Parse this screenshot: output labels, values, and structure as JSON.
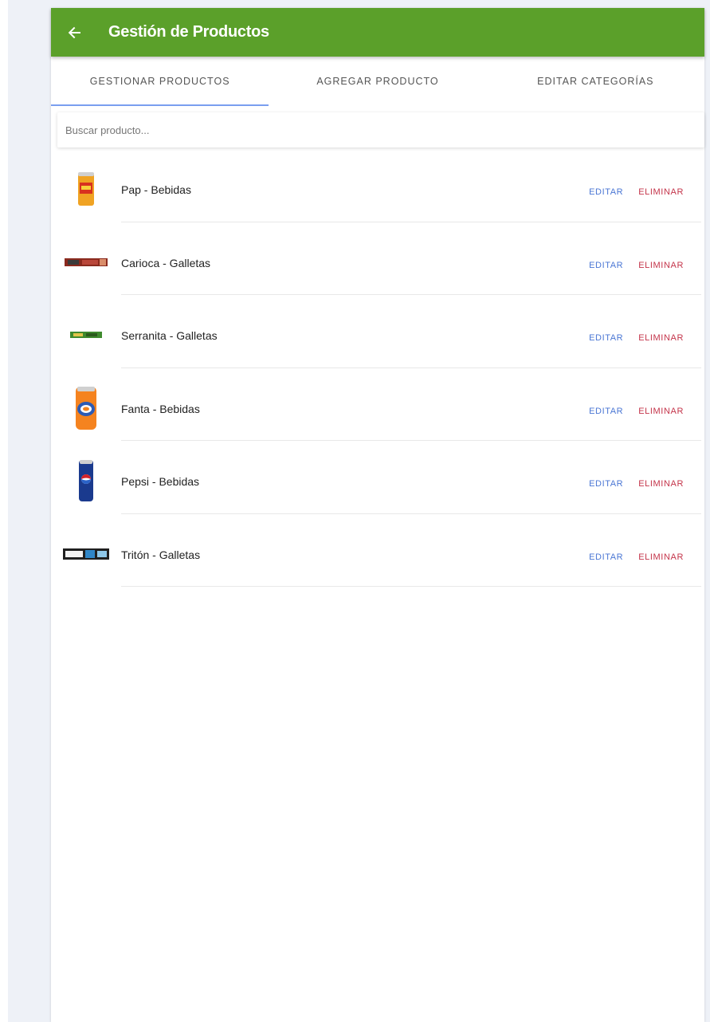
{
  "header": {
    "title": "Gestión de Productos",
    "back_icon": "arrow-left-icon",
    "color": "#5ba02a"
  },
  "tabs": [
    {
      "label": "GESTIONAR PRODUCTOS",
      "active": true
    },
    {
      "label": "AGREGAR PRODUCTO",
      "active": false
    },
    {
      "label": "EDITAR CATEGORÍAS",
      "active": false
    }
  ],
  "search": {
    "placeholder": "Buscar producto...",
    "value": ""
  },
  "products": [
    {
      "label": "Pap - Bebidas",
      "image": "pap-can"
    },
    {
      "label": "Carioca - Galletas",
      "image": "carioca-pack"
    },
    {
      "label": "Serranita - Galletas",
      "image": "serranita-pack"
    },
    {
      "label": "Fanta - Bebidas",
      "image": "fanta-can"
    },
    {
      "label": "Pepsi - Bebidas",
      "image": "pepsi-can"
    },
    {
      "label": "Tritón - Galletas",
      "image": "triton-pack"
    }
  ],
  "actions": {
    "edit_label": "EDITAR",
    "delete_label": "ELIMINAR",
    "edit_color": "#4a76d4",
    "delete_color": "#c4344a"
  }
}
